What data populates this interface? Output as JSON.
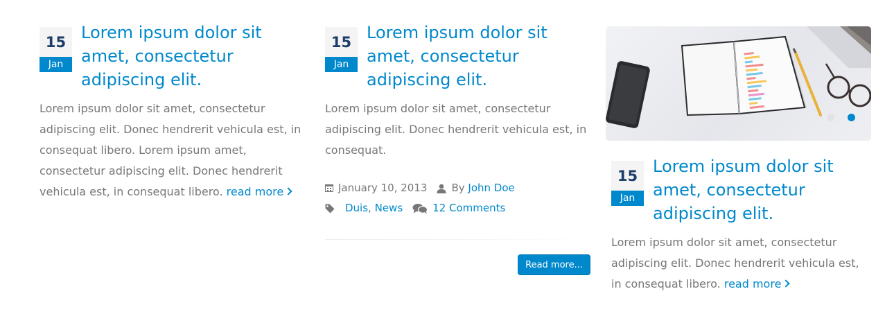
{
  "posts": [
    {
      "day": "15",
      "month": "Jan",
      "title": "Lorem ipsum dolor sit amet, consectetur adipiscing elit.",
      "excerpt": "Lorem ipsum dolor sit amet, consectetur adipiscing elit. Donec hendrerit vehicula est, in consequat libero. Lorem ipsum amet, consectetur adipiscing elit. Donec hendrerit vehicula est, in consequat libero.",
      "read_more": "read more"
    },
    {
      "day": "15",
      "month": "Jan",
      "title": "Lorem ipsum dolor sit amet, consectetur adipiscing elit.",
      "excerpt": "Lorem ipsum dolor sit amet, consectetur adipiscing elit. Donec hendrerit vehicula est, in consequat.",
      "meta": {
        "date": "January 10, 2013",
        "by_label": "By",
        "author": "John Doe",
        "tag_1": "Duis",
        "tag_sep": ",",
        "tag_2": "News",
        "comments": "12 Comments"
      },
      "button": "Read more..."
    },
    {
      "day": "15",
      "month": "Jan",
      "title": "Lorem ipsum dolor sit amet, consectetur adipiscing elit.",
      "excerpt": "Lorem ipsum dolor sit amet, consectetur adipiscing elit. Donec hendrerit vehicula est, in consequat libero.",
      "read_more": "read more",
      "slider": {
        "dot_count": 2,
        "active_dot": 2
      }
    }
  ],
  "colors": {
    "accent": "#0088cc",
    "text": "#777777",
    "date_day": "#1d3d6b",
    "date_bg": "#f4f4f4"
  }
}
